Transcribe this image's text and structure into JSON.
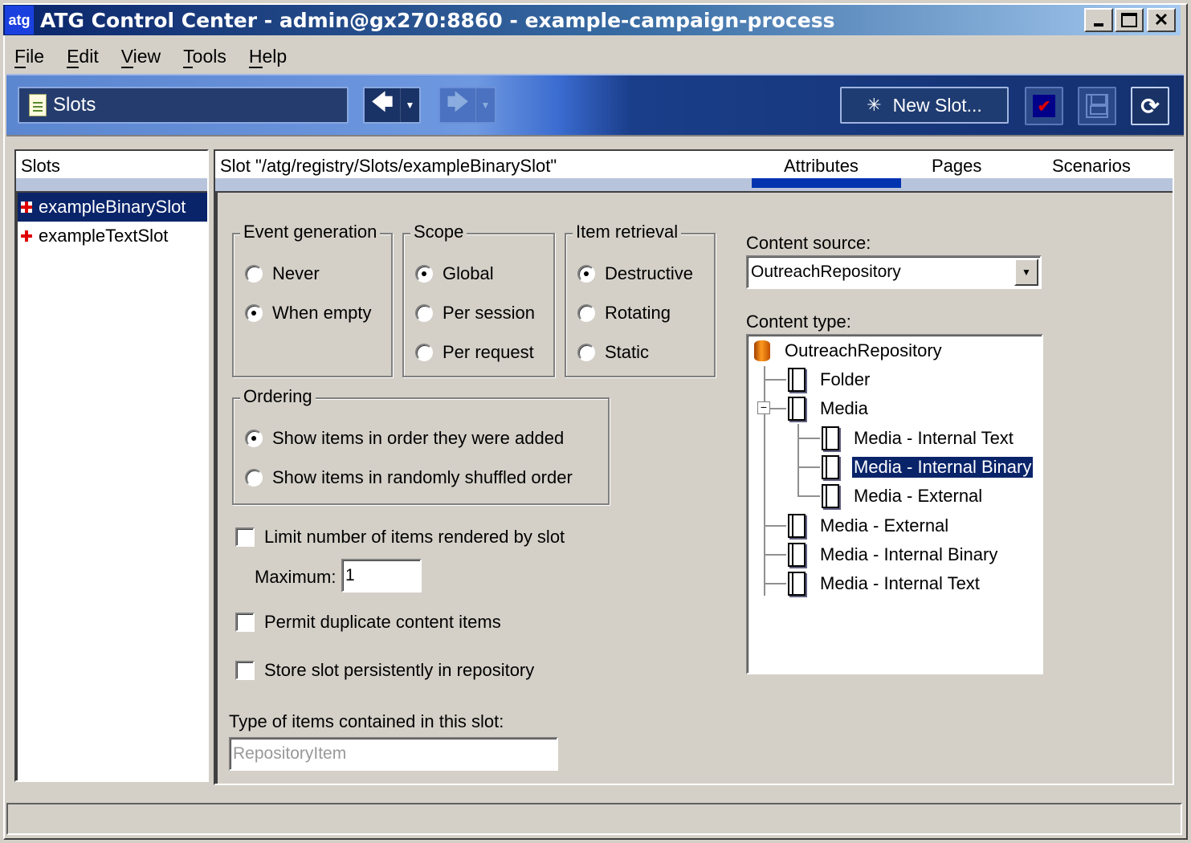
{
  "window": {
    "logo_text": "atg",
    "title": "ATG Control Center - admin@gx270:8860 - example-campaign-process",
    "controls": {
      "minimize": "_",
      "maximize": "□",
      "close": "✕"
    }
  },
  "menu": [
    {
      "label": "File",
      "mnemonic": "F"
    },
    {
      "label": "Edit",
      "mnemonic": "E"
    },
    {
      "label": "View",
      "mnemonic": "V"
    },
    {
      "label": "Tools",
      "mnemonic": "T"
    },
    {
      "label": "Help",
      "mnemonic": "H"
    }
  ],
  "toolbar": {
    "section_label": "Slots",
    "back_icon": "arrow-left-icon",
    "forward_icon": "arrow-right-icon",
    "dropdown_glyph": "▼",
    "new_slot_label": "New Slot...",
    "new_slot_icon": "✳",
    "check_glyph": "✔",
    "refresh_glyph": "⟳"
  },
  "left_panel": {
    "header": "Slots",
    "items": [
      {
        "label": "exampleBinarySlot",
        "selected": true
      },
      {
        "label": "exampleTextSlot",
        "selected": false
      }
    ]
  },
  "right_panel": {
    "slot_path": "Slot \"/atg/registry/Slots/exampleBinarySlot\"",
    "tabs": [
      {
        "label": "Attributes",
        "active": true
      },
      {
        "label": "Pages",
        "active": false
      },
      {
        "label": "Scenarios",
        "active": false
      }
    ],
    "event_generation": {
      "title": "Event generation",
      "options": [
        {
          "label": "Never",
          "checked": false
        },
        {
          "label": "When empty",
          "checked": true
        }
      ]
    },
    "scope": {
      "title": "Scope",
      "options": [
        {
          "label": "Global",
          "checked": true
        },
        {
          "label": "Per session",
          "checked": false
        },
        {
          "label": "Per request",
          "checked": false
        }
      ]
    },
    "item_retrieval": {
      "title": "Item retrieval",
      "options": [
        {
          "label": "Destructive",
          "checked": true
        },
        {
          "label": "Rotating",
          "checked": false
        },
        {
          "label": "Static",
          "checked": false
        }
      ]
    },
    "ordering": {
      "title": "Ordering",
      "options": [
        {
          "label": "Show items in order they were added",
          "checked": true
        },
        {
          "label": "Show items in randomly shuffled order",
          "checked": false
        }
      ]
    },
    "limit_items": {
      "label": "Limit number of items rendered by slot",
      "checked": false
    },
    "maximum": {
      "label": "Maximum:",
      "value": "1"
    },
    "permit_duplicates": {
      "label": "Permit duplicate content items",
      "checked": false
    },
    "store_persistently": {
      "label": "Store slot persistently in repository",
      "checked": false
    },
    "item_type": {
      "label": "Type of items contained in this slot:",
      "value": "RepositoryItem"
    },
    "content_source": {
      "label": "Content source:",
      "value": "OutreachRepository"
    },
    "content_type": {
      "label": "Content type:",
      "root": "OutreachRepository",
      "nodes": [
        {
          "label": "Folder",
          "level": 1
        },
        {
          "label": "Media",
          "level": 1,
          "expanded": true
        },
        {
          "label": "Media - Internal Text",
          "level": 2
        },
        {
          "label": "Media - Internal Binary",
          "level": 2,
          "selected": true
        },
        {
          "label": "Media - External",
          "level": 2
        },
        {
          "label": "Media - External",
          "level": 1
        },
        {
          "label": "Media - Internal Binary",
          "level": 1
        },
        {
          "label": "Media - Internal Text",
          "level": 1
        }
      ],
      "expander_glyph": "−"
    }
  },
  "status_bar": {
    "text": ""
  }
}
